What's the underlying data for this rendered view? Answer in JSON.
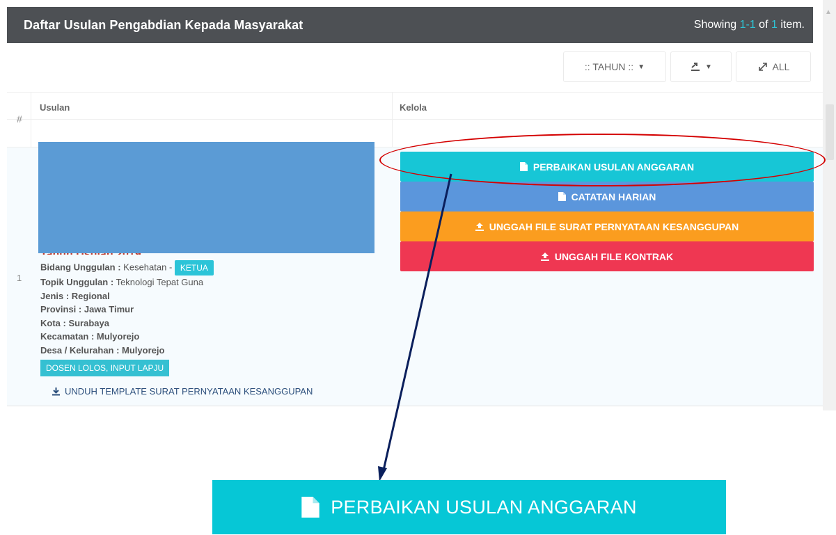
{
  "header": {
    "title": "Daftar Usulan Pengabdian Kepada Masyarakat",
    "summary_prefix": "Showing",
    "summary_range": "1-1",
    "summary_of": "of",
    "summary_total": "1",
    "summary_suffix": "item."
  },
  "toolbar": {
    "year_filter": ":: TAHUN ::",
    "export_icon": "export-icon",
    "all_label": "ALL"
  },
  "table": {
    "col_hash": "#",
    "col_usulan": "Usulan",
    "col_kelola": "Kelola"
  },
  "row": {
    "number": "1",
    "tahun": "Tahun Usulan 2019",
    "bidang_label": "Bidang Unggulan :",
    "bidang_value": "Kesehatan -",
    "role_badge": "KETUA",
    "topik_label": "Topik Unggulan :",
    "topik_value": "Teknologi Tepat Guna",
    "jenis": "Jenis : Regional",
    "provinsi": "Provinsi : Jawa Timur",
    "kota": "Kota : Surabaya",
    "kecamatan": "Kecamatan : Mulyorejo",
    "desa": "Desa / Kelurahan : Mulyorejo",
    "status": "DOSEN LOLOS, INPUT LAPJU",
    "download_link": "UNDUH TEMPLATE SURAT PERNYATAAN KESANGGUPAN"
  },
  "actions": [
    {
      "label": "PERBAIKAN USULAN ANGGARAN",
      "icon": "file-icon",
      "color": "#17c6d6"
    },
    {
      "label": "CATATAN HARIAN",
      "icon": "file-icon",
      "color": "#5b96dc"
    },
    {
      "label": "UNGGAH FILE SURAT PERNYATAAN KESANGGUPAN",
      "icon": "upload-icon",
      "color": "#fb9d1f"
    },
    {
      "label": "UNGGAH FILE KONTRAK",
      "icon": "upload-icon",
      "color": "#ef3752"
    }
  ],
  "zoom": {
    "label": "PERBAIKAN USULAN ANGGARAN"
  },
  "colors": {
    "header_bg": "#4d5054",
    "highlight_text": "#2ec4d6",
    "annotation_ellipse": "#d40000",
    "annotation_arrow": "#0a1f5c",
    "redaction": "#5b9bd5"
  }
}
